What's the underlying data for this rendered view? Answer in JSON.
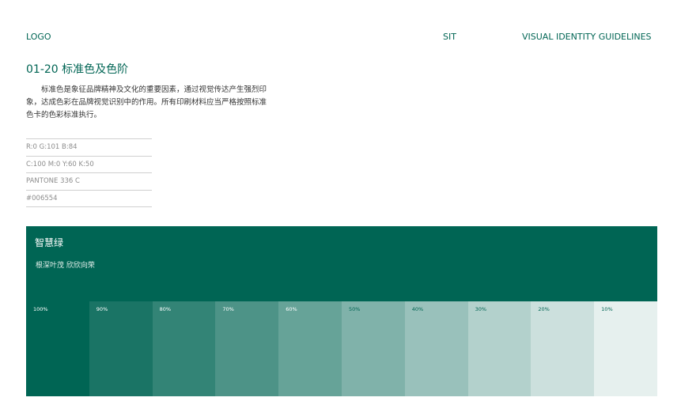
{
  "header": {
    "logo": "LOGO",
    "project": "SIT",
    "guide": "VISUAL IDENTITY GUIDELINES"
  },
  "section": {
    "title": "01-20 标准色及色阶",
    "description": "标准色是象征品牌精神及文化的重要因素，通过视觉传达产生强烈印象，达成色彩在品牌视觉识别中的作用。所有印刷材料应当严格按照标准色卡的色彩标准执行。"
  },
  "specs": [
    "R:0 G:101 B:84",
    "C:100 M:0 Y:60 K:50",
    "PANTONE 336 C",
    "#006554"
  ],
  "swatch": {
    "name": "智慧绿",
    "slogan": "根深叶茂 欣欣向荣",
    "color": "#006554"
  },
  "tints": [
    {
      "label": "100%",
      "color": "#006554",
      "text_color": "#ffffff"
    },
    {
      "label": "90%",
      "color": "#1a7465",
      "text_color": "#ffffff"
    },
    {
      "label": "80%",
      "color": "#338476",
      "text_color": "#ffffff"
    },
    {
      "label": "70%",
      "color": "#4d9387",
      "text_color": "#ffffff"
    },
    {
      "label": "60%",
      "color": "#66a398",
      "text_color": "#ffffff"
    },
    {
      "label": "50%",
      "color": "#80b2aa",
      "text_color": "#006554"
    },
    {
      "label": "40%",
      "color": "#99c1bb",
      "text_color": "#006554"
    },
    {
      "label": "30%",
      "color": "#b3d1cc",
      "text_color": "#006554"
    },
    {
      "label": "20%",
      "color": "#cce0dd",
      "text_color": "#006554"
    },
    {
      "label": "10%",
      "color": "#e6f0ee",
      "text_color": "#006554"
    }
  ]
}
